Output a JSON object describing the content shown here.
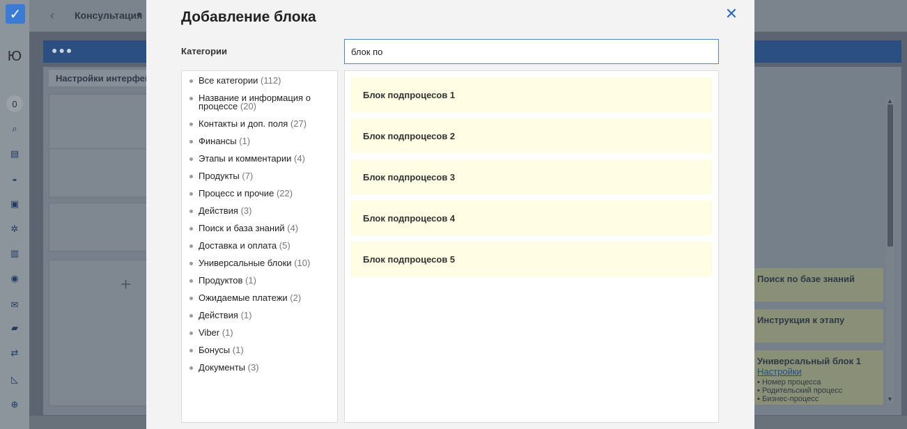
{
  "background": {
    "app_title": "Консультация",
    "avatar_letter": "Ю",
    "counter": "0",
    "tab_label": "Настройки интерфейса",
    "right_cards": [
      {
        "title": "Поиск по базе знаний"
      },
      {
        "title": "Инструкция к этапу"
      },
      {
        "title": "Универсальный блок 1",
        "link": "Настройки",
        "items": [
          "Номер процесса",
          "Родительский процесс",
          "Бизнес-процесс"
        ]
      }
    ]
  },
  "modal": {
    "title": "Добавление блока",
    "categories_label": "Категории",
    "search_value": "блок по",
    "close_icon": "close-icon",
    "categories": [
      {
        "name": "Все категории",
        "count": "(112)"
      },
      {
        "name": "Название и информация о процессе",
        "count": "(20)"
      },
      {
        "name": "Контакты и доп. поля",
        "count": "(27)"
      },
      {
        "name": "Финансы",
        "count": "(1)"
      },
      {
        "name": "Этапы и комментарии",
        "count": "(4)"
      },
      {
        "name": "Продукты",
        "count": "(7)"
      },
      {
        "name": "Процесс и прочие",
        "count": "(22)"
      },
      {
        "name": "Действия",
        "count": "(3)"
      },
      {
        "name": "Поиск и база знаний",
        "count": "(4)"
      },
      {
        "name": "Доставка и оплата",
        "count": "(5)"
      },
      {
        "name": "Универсальные блоки",
        "count": "(10)"
      },
      {
        "name": "Продуктов",
        "count": "(1)"
      },
      {
        "name": "Ожидаемые платежи",
        "count": "(2)"
      },
      {
        "name": "Действия",
        "count": "(1)"
      },
      {
        "name": "Viber",
        "count": "(1)"
      },
      {
        "name": "Бонусы",
        "count": "(1)"
      },
      {
        "name": "Документы",
        "count": "(3)"
      }
    ],
    "blocks": [
      "Блок подпроцесов 1",
      "Блок подпроцесов 2",
      "Блок подпроцесов 3",
      "Блок подпроцесов 4",
      "Блок подпроцесов 5"
    ]
  }
}
